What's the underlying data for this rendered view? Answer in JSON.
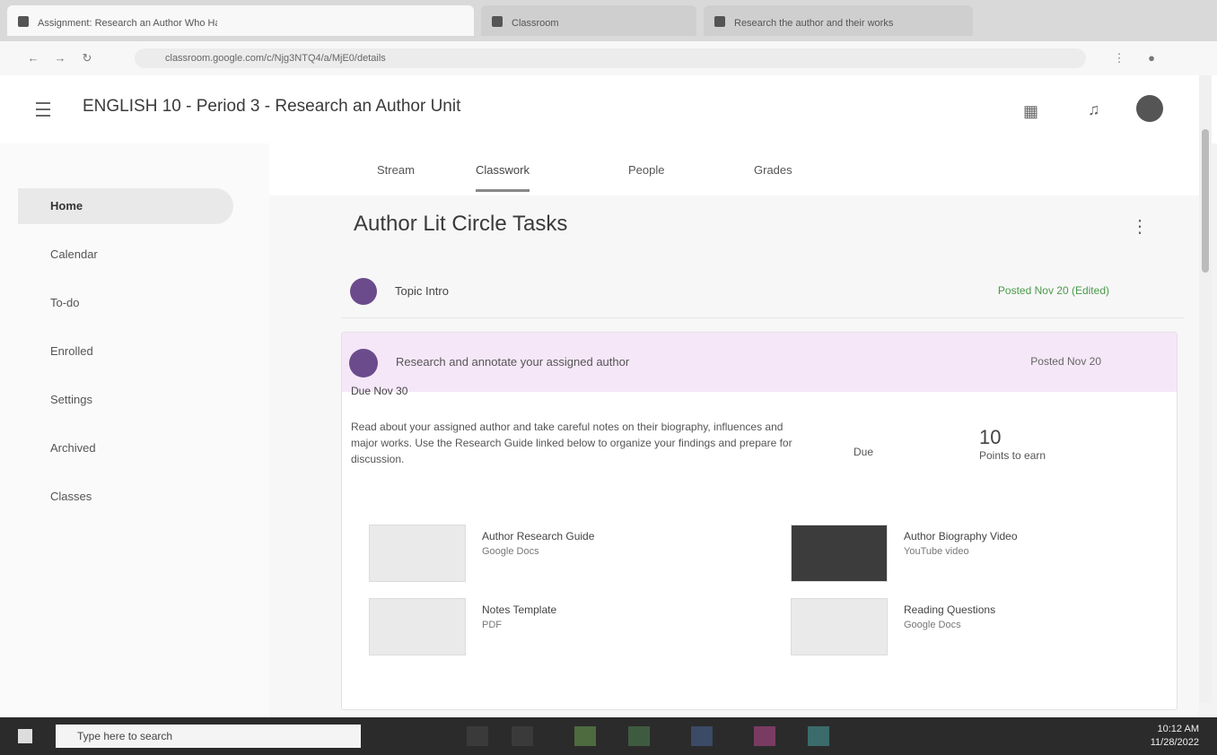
{
  "browser": {
    "tabs": [
      {
        "title": "Assignment: Research an Author Who Has Influenced Literature",
        "active": true
      },
      {
        "title": "Classroom",
        "active": false
      },
      {
        "title": "Research the author and their works",
        "active": false
      }
    ],
    "url": "classroom.google.com/c/Njg3NTQ4/a/MjE0/details"
  },
  "app": {
    "title": "ENGLISH 10 - Period 3 - Research an Author Unit",
    "icons": [
      "apps-icon",
      "bell-icon",
      "avatar"
    ]
  },
  "sidebar": {
    "items": [
      {
        "label": "Home",
        "active": true
      },
      {
        "label": "Calendar",
        "active": false
      },
      {
        "label": "To-do",
        "active": false
      },
      {
        "label": "Enrolled",
        "active": false
      },
      {
        "label": "Settings",
        "active": false
      },
      {
        "label": "Archived",
        "active": false
      },
      {
        "label": "Classes",
        "active": false
      }
    ]
  },
  "subtabs": [
    {
      "label": "Stream",
      "active": false
    },
    {
      "label": "Classwork",
      "active": true
    },
    {
      "label": "People",
      "active": false
    },
    {
      "label": "Grades",
      "active": false
    }
  ],
  "section": {
    "title": "Author Lit Circle Tasks"
  },
  "row1": {
    "label": "Topic Intro",
    "date": "Posted Nov 20 (Edited)"
  },
  "card": {
    "title": "Research and annotate your assigned author",
    "date": "Posted Nov 20",
    "subtitle": "Due Nov 30",
    "description": "Read about your assigned author and take careful notes on their biography, influences and major works. Use the Research Guide linked below to organize your findings and prepare for discussion.",
    "due_label": "Due",
    "points": "10",
    "points_label": "Points to earn",
    "attachments": [
      {
        "title": "Author Research Guide",
        "type": "Google Docs"
      },
      {
        "title": "Notes Template",
        "type": "PDF"
      },
      {
        "title": "Author Biography Video",
        "type": "YouTube video"
      },
      {
        "title": "Reading Questions",
        "type": "Google Docs"
      }
    ]
  },
  "taskbar": {
    "search_placeholder": "Type here to search",
    "time": "10:12 AM",
    "date": "11/28/2022"
  },
  "colors": {
    "accent": "#6b4b8c",
    "card_header": "#f5e7f8"
  }
}
